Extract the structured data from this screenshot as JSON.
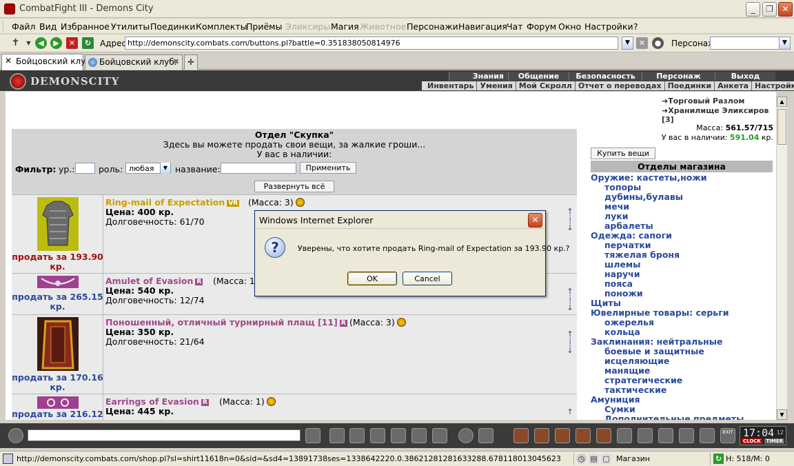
{
  "window": {
    "title": "CombatFight III - Demons City"
  },
  "menu": [
    "Файл",
    "Вид",
    "Избранное",
    "Утилиты",
    "Поединки",
    "Комплекты",
    "Приёмы",
    "Эликсиры",
    "Магия",
    "Животное",
    "Персонажи",
    "Навигация",
    "Чат",
    "Форум",
    "Окно",
    "Настройки",
    "?"
  ],
  "addressbar": {
    "label": "Адрес:",
    "url": "http://demonscity.combats.com/buttons.pl?battle=0.351838050814976",
    "persona_label": "Персонаж:"
  },
  "tabs": [
    {
      "label": "Бойцовский клуб"
    },
    {
      "label": "Бойцовский клуб."
    }
  ],
  "game": {
    "logo": "DEMONSCITY",
    "topnav": [
      "Знания",
      "Общение",
      "Безопасность",
      "Персонаж",
      "Выход"
    ],
    "subnav": [
      "Инвентарь",
      "Умения",
      "Мой Скролл",
      "Отчет о переводах",
      "Поединки",
      "Анкета",
      "Настройки"
    ]
  },
  "right_panel": {
    "links": [
      "Торговый Разлом",
      "Хранилище Эликсиров [3]"
    ],
    "mass_label": "Масса:",
    "mass_value": "561.57/715",
    "money_label": "У вас в наличии:",
    "money_value": "591.04",
    "money_unit": "кр.",
    "buy_button": "Купить вещи",
    "departments_title": "Отделы магазина",
    "departments": [
      {
        "label": "Оружие: кастеты,ножи",
        "sub": false
      },
      {
        "label": "топоры",
        "sub": true
      },
      {
        "label": "дубины,булавы",
        "sub": true
      },
      {
        "label": "мечи",
        "sub": true
      },
      {
        "label": "луки",
        "sub": true
      },
      {
        "label": "арбалеты",
        "sub": true
      },
      {
        "label": "Одежда: сапоги",
        "sub": false
      },
      {
        "label": "перчатки",
        "sub": true
      },
      {
        "label": "тяжелая броня",
        "sub": true
      },
      {
        "label": "шлемы",
        "sub": true
      },
      {
        "label": "наручи",
        "sub": true
      },
      {
        "label": "пояса",
        "sub": true
      },
      {
        "label": "поножи",
        "sub": true
      },
      {
        "label": "Щиты",
        "sub": false
      },
      {
        "label": "Ювелирные товары: серьги",
        "sub": false
      },
      {
        "label": "ожерелья",
        "sub": true
      },
      {
        "label": "кольца",
        "sub": true
      },
      {
        "label": "Заклинания: нейтральные",
        "sub": false
      },
      {
        "label": "боевые и защитные",
        "sub": true
      },
      {
        "label": "исцеляющие",
        "sub": true
      },
      {
        "label": "манящие",
        "sub": true
      },
      {
        "label": "стратегические",
        "sub": true
      },
      {
        "label": "тактические",
        "sub": true
      },
      {
        "label": "Амуниция",
        "sub": false
      },
      {
        "label": "Сумки",
        "sub": true
      },
      {
        "label": "Дополнительные предметы",
        "sub": true
      }
    ]
  },
  "shop": {
    "title": "Отдел \"Скупка\"",
    "subtitle": "Здесь вы можете продать свои вещи, за жалкие гроши...",
    "have_label": "У вас в наличии:",
    "filter": {
      "label": "Фильтр:",
      "level_label": "ур.:",
      "role_label": "роль:",
      "role_value": "любая",
      "name_label": "название:",
      "apply": "Применить"
    },
    "expand_all": "Развернуть всё",
    "items": [
      {
        "name": "Ring-mail of Expectation",
        "badge": "VR",
        "mass": "(Масса: 3)",
        "price": "Цена: 400 кр.",
        "durability": "Долговечность: 61/70",
        "sell": "продать за 193.90 кр.",
        "sell_color": "#a01010",
        "name_color": "#c8a000"
      },
      {
        "name": "Amulet of Evasion",
        "badge": "R",
        "mass": "(Масса: 1)",
        "price": "Цена: 540 кр.",
        "durability": "Долговечность: 12/74",
        "sell": "продать за 265.15 кр.",
        "sell_color": "#2a4a9a",
        "name_color": "#a0498a"
      },
      {
        "name": "Поношенный, отличный турнирный плащ [11]",
        "badge": "R",
        "mass": "(Масса: 3)",
        "price": "Цена: 350 кр.",
        "durability": "Долговечность: 21/64",
        "sell": "продать за 170.16 кр.",
        "sell_color": "#2a4a9a",
        "name_color": "#a0498a"
      },
      {
        "name": "Earrings of Evasion",
        "badge": "R",
        "mass": "(Масса: 1)",
        "price": "Цена: 445 кр.",
        "durability": "",
        "sell": "продать за 216.12",
        "sell_color": "#2a4a9a",
        "name_color": "#a0498a"
      }
    ]
  },
  "dialog": {
    "title": "Windows Internet Explorer",
    "message": "Уверены, что хотите продать Ring-mail of Expectation за 193.90 кр.?",
    "ok": "OK",
    "cancel": "Cancel"
  },
  "clock": {
    "time": "17:04",
    "seconds": "12",
    "clock_label": "CLOCK",
    "timer_label": "TIMER",
    "exit_label": "EXIT"
  },
  "statusbar": {
    "url": "http://demonscity.combats.com/shop.pl?sl=shirt11618n=0&sid=&sd4=13891738ses=1338642220.0.38621281281633288.678118013045623",
    "zone": "Магазин",
    "hm": "H: 518/M: 0"
  }
}
